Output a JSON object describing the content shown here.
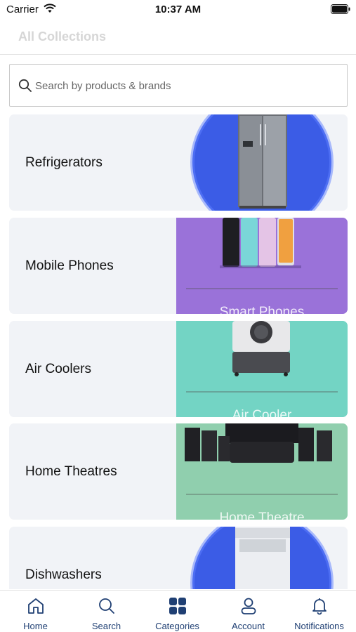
{
  "status_bar": {
    "carrier": "Carrier",
    "time": "10:37 AM"
  },
  "header": {
    "title": "All Collections"
  },
  "search": {
    "placeholder": "Search by products & brands",
    "value": ""
  },
  "collections": [
    {
      "label": "Refrigerators",
      "banner_text": ""
    },
    {
      "label": "Mobile Phones",
      "banner_text": "Smart Phones"
    },
    {
      "label": "Air Coolers",
      "banner_text": "Air Cooler"
    },
    {
      "label": "Home Theatres",
      "banner_text": "Home Theatre"
    },
    {
      "label": "Dishwashers",
      "banner_text": ""
    }
  ],
  "nav": {
    "items": [
      {
        "label": "Home",
        "icon": "home-icon"
      },
      {
        "label": "Search",
        "icon": "search-icon"
      },
      {
        "label": "Categories",
        "icon": "grid-icon",
        "active": true
      },
      {
        "label": "Account",
        "icon": "person-icon"
      },
      {
        "label": "Notifications",
        "icon": "bell-icon"
      }
    ]
  },
  "colors": {
    "nav_accent": "#1f3f73",
    "card_bg": "#f1f3f7",
    "blue_circle": "#3b5ce6",
    "purple_banner": "#9a72d9",
    "teal_banner": "#73d4c4",
    "green_banner": "#90cfae"
  }
}
